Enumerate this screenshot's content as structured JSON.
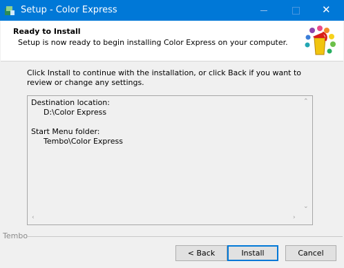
{
  "window": {
    "title": "Setup - Color Express"
  },
  "header": {
    "title": "Ready to Install",
    "subtitle": "Setup is now ready to begin installing Color Express on your computer."
  },
  "intro_text": "Click Install to continue with the installation, or click Back if you want to review or change any settings.",
  "summary": {
    "destination_label": "Destination location:",
    "destination_value": "D:\\Color Express",
    "start_menu_label": "Start Menu folder:",
    "start_menu_value": "Tembo\\Color Express"
  },
  "footer": {
    "brand": "Tembo",
    "back_label": "< Back",
    "install_label": "Install",
    "cancel_label": "Cancel"
  },
  "icons": {
    "app": "setup-app-icon",
    "logo": "paint-bucket-logo"
  },
  "colors": {
    "titlebar": "#0078d7",
    "default_button_border": "#0078d7"
  }
}
